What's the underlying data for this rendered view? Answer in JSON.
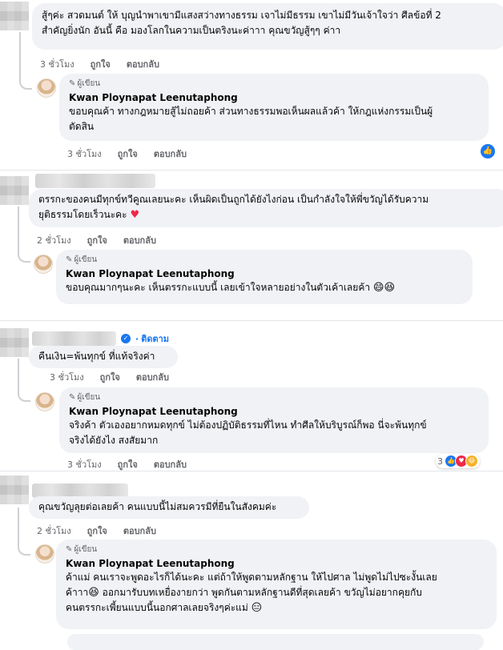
{
  "author_badge": "ผู้เขียน",
  "author_name": "Kwan Ploynapat Leenutaphong",
  "actions": {
    "like": "ถูกใจ",
    "reply": "ตอบกลับ"
  },
  "follow_label": "ติดตาม",
  "comments": [
    {
      "text_lines": [
        "สู้ๆค่ะ สวดมนต์ ให้ บุญนำพาเขามีแสงสว่างทางธรรม เจาไม่มีธรรม เขาไม่มีวันเจ้าใจว่า ศีลข้อที่ 2",
        "สำคัญยิ่งนัก อันนี้ คือ มองโลกในความเป็นตริงนะค่าาา คุณขวัญสู้ๆๆ ค่าา"
      ],
      "time": "3 ชั่วโมง",
      "reply": {
        "text_lines": [
          "ขอบคุณค้า ทางกฎหมายสู้ไม่ถอยค้า ส่วนทางธรรมพอเห็นผลแล้วค้า ให้กฎแห่งกรรมเป็นผู้",
          "ตัดสิน"
        ],
        "time": "3 ชั่วโมง",
        "reaction_icon": "like-icon"
      }
    },
    {
      "text_lines": [
        "ตรรกะของคนมีทุกข์ทวีคูณเลยนะคะ เห็นผิดเป็นถูกได้ยังไงก่อน เป็นกำลังใจให้พี่ขวัญได้รับความ",
        "ยุติธรรมโดยเร็วนะคะ"
      ],
      "text_emoji": "♥",
      "time": "2 ชั่วโมง",
      "reply": {
        "text_lines": [
          "ขอบคุณมากๆนะคะ เห็นตรรกะแบบนี้ เลยเข้าใจหลายอย่างในตัวเค้าเลยค้า"
        ],
        "text_emoji": "😄😆",
        "time": "2 ชั่วโมง"
      }
    },
    {
      "text_lines": [
        "คืนเงิน=พ้นทุกข์ ที่แท้จริงค่า"
      ],
      "time": "3 ชั่วโมง",
      "reply": {
        "text_lines": [
          "จริงค้า ตัวเองอยากหมดทุกข์ ไม่ต้องปฏิบัติธรรมที่ไหน ทำศีลให้บริบูรณ์ก็พอ นี่จะพ้นทุกข์",
          "จริงได้ยังไง สงสัยมาก"
        ],
        "time": "3 ชั่วโมง",
        "reaction_count": "3"
      }
    },
    {
      "text_lines": [
        "คุณขวัญลุยต่อเลยค้า คนแบบนี้ไม่สมควรมีที่ยืนในสังคมค่ะ"
      ],
      "time": "2 ชั่วโมง",
      "reply": {
        "text_lines": [
          "ค้าแม่ คนเราจะพูดอะไรก็ได้นะคะ แต่ถ้าให้พูดตามหลักฐาน ให้ไปศาล ไม่พูดไม่ไปซะงั้นเลย",
          "ค้าาา",
          "ออกมารับบทเหยื่องายกว่า พูดกันตามหลักฐานดีที่สุดเลยค้า ขวัญไม่อยากคุยกับ",
          "คนตรรกะเพี้ยนแบบนี้นอกศาลเลยจริงๆค่ะแม่"
        ],
        "text_emoji_mid": "😆",
        "text_emoji_end": "😑"
      }
    }
  ]
}
